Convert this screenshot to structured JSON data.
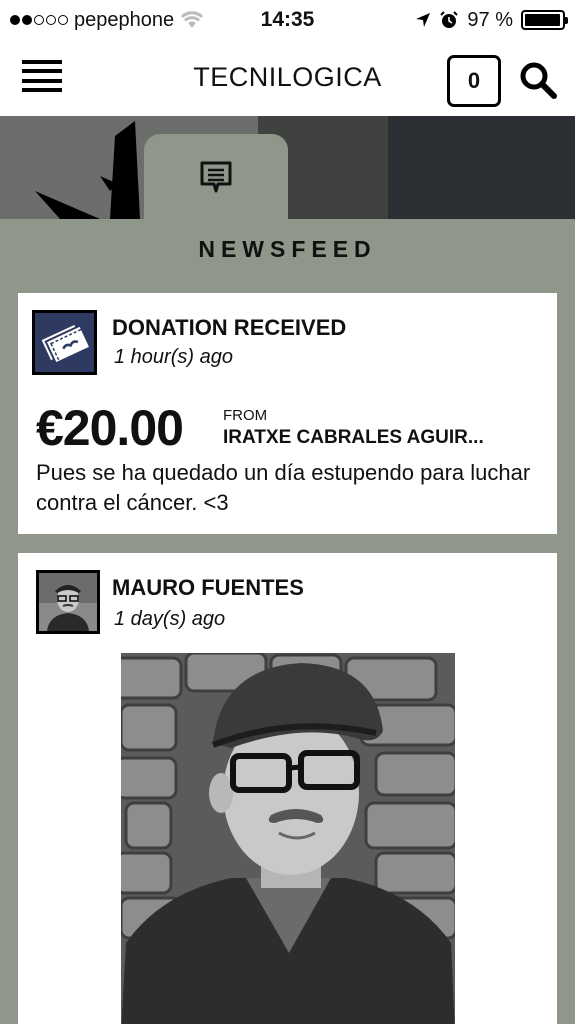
{
  "status_bar": {
    "carrier": "pepephone",
    "time": "14:35",
    "battery": "97 %",
    "battery_level": 0.97
  },
  "app": {
    "title": "TECNILOGICA",
    "cart_count": "0"
  },
  "section_title": "NEWSFEED",
  "feed": [
    {
      "title": "DONATION RECEIVED",
      "time": "1 hour(s) ago",
      "amount": "€20.00",
      "from_label": "FROM",
      "from_name": "IRATXE CABRALES AGUIR...",
      "message": "Pues se ha quedado un día estupendo para luchar contra el cáncer. <3"
    },
    {
      "title": "MAURO FUENTES",
      "time": "1 day(s) ago"
    }
  ]
}
